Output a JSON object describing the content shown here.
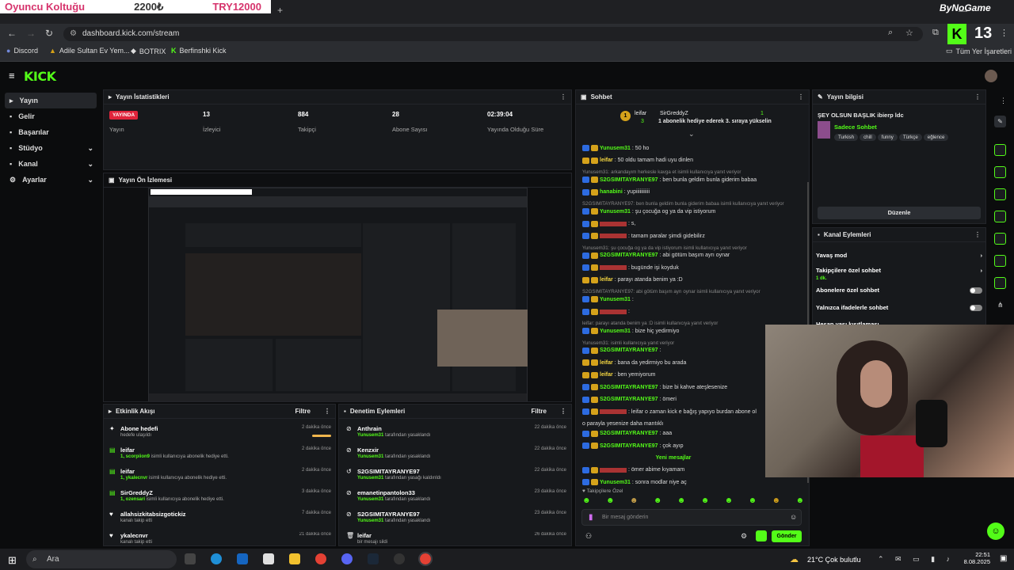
{
  "overlay": {
    "left": "Oyuncu Koltuğu",
    "mid": "2200₺",
    "right": "TRY12000",
    "right_top": "ByNoGame"
  },
  "browser": {
    "url": "dashboard.kick.com/stream",
    "channel_number": "13"
  },
  "bookmarks": [
    "Discord",
    "Adile Sultan Ev Yem...",
    "BOTRIX",
    "Berfinshki Kick"
  ],
  "bookmarks_all": "Tüm Yer İşaretleri",
  "app": {
    "logo": "KICK"
  },
  "sidebar": {
    "items": [
      {
        "label": "Yayın"
      },
      {
        "label": "Gelir"
      },
      {
        "label": "Başarılar"
      },
      {
        "label": "Stüdyo"
      },
      {
        "label": "Kanal"
      },
      {
        "label": "Ayarlar"
      }
    ]
  },
  "stats": {
    "title": "Yayın İstatistikleri",
    "live": "YAYINDA",
    "live_label": "Yayın",
    "viewers": "13",
    "viewers_label": "İzleyici",
    "followers": "884",
    "followers_label": "Takipçi",
    "subs": "28",
    "subs_label": "Abone Sayısı",
    "uptime": "02:39:04",
    "uptime_label": "Yayında Olduğu Süre"
  },
  "preview": {
    "title": "Yayın Ön İzlemesi"
  },
  "activity": {
    "title": "Etkinlik Akışı",
    "filter": "Filtre",
    "rows": [
      {
        "title": "Abone hedefi",
        "sub": "hedefe ulaşıldı",
        "time": "2 dakika önce"
      },
      {
        "title": "leifar",
        "user": "1, scorpiion9",
        "sub": " isimli kullanıcıya abonelik hediye etti.",
        "time": "2 dakika önce"
      },
      {
        "title": "leifar",
        "user": "1, ykalecnvr",
        "sub": " isimli kullanıcıya abonelik hediye etti.",
        "time": "2 dakika önce"
      },
      {
        "title": "SirGreddyZ",
        "user": "1, ozensari",
        "sub": " isimli kullanıcıya abonelik hediye etti.",
        "time": "3 dakika önce"
      },
      {
        "title": "allahsizkitabsizgotickiz",
        "sub": "kanalı takip etti",
        "time": "7 dakika önce"
      },
      {
        "title": "ykalecnvr",
        "sub": "kanalı takip etti",
        "time": "21 dakika önce"
      }
    ]
  },
  "moderation": {
    "title": "Denetim Eylemleri",
    "filter": "Filtre",
    "rows": [
      {
        "title": "Anthrain",
        "user": "Yunusem31",
        "sub": " tarafından yasaklandı",
        "time": "22 dakika önce"
      },
      {
        "title": "Kenzxir",
        "user": "Yunusem31",
        "sub": " tarafından yasaklandı",
        "time": "22 dakika önce"
      },
      {
        "title": "S2GSIMITAYRANYE97",
        "user": "Yunusem31",
        "sub": " tarafından yasağı kaldırıldı",
        "time": "22 dakika önce"
      },
      {
        "title": "emanetinpantolon33",
        "user": "Yunusem31",
        "sub": " tarafından yasaklandı",
        "time": "23 dakika önce"
      },
      {
        "title": "S2GSIMITAYRANYE97",
        "user": "Yunusem31",
        "sub": " tarafından yasaklandı",
        "time": "23 dakika önce"
      },
      {
        "title": "leifar",
        "sub": "bir mesajı sildi",
        "time": "26 dakika önce"
      }
    ]
  },
  "chat": {
    "title": "Sohbet",
    "pinned": {
      "user1": "leifar",
      "count1": "3",
      "user2": "SirGreddyZ",
      "count2": "1",
      "text": "1 abonelik hediye ederek 3. sıraya yükselin"
    },
    "messages": [
      {
        "type": "msg",
        "user": "Yunusem31",
        "color": "u-green",
        "text": ": 50 ho"
      },
      {
        "type": "msg",
        "user": "leifar",
        "color": "u-yellow",
        "text": ": 50 oldu tamam hadi uyu dinlen"
      },
      {
        "type": "reply",
        "text": "Yunusem31: arkandayım herkesle kavga et isimli kullanıcıya yanıt veriyor"
      },
      {
        "type": "msg",
        "user": "S2GSIMITAYRANYE97",
        "color": "u-green",
        "text": ": ben bunla geldim bunla giderim babaa"
      },
      {
        "type": "msg",
        "user": "hanabini",
        "color": "u-green",
        "text": ": yupiiiiiiiiiii"
      },
      {
        "type": "reply",
        "text": "S2GSIMITAYRANYE97: ben bunla geldim bunla giderim babaa isimli kullanıcıya yanıt veriyor"
      },
      {
        "type": "msg",
        "user": "Yunusem31",
        "color": "u-green",
        "text": ": şu çocuğa og ya da vip istiyorum"
      },
      {
        "type": "msg",
        "user": "",
        "color": "u-pink",
        "text": ": s,"
      },
      {
        "type": "msg",
        "user": "",
        "color": "u-purple",
        "text": ": tamam paralar şimdi gidebilirz"
      },
      {
        "type": "reply",
        "text": "Yunusem31: şu çocuğa og ya da vip istiyorum isimli kullanıcıya yanıt veriyor"
      },
      {
        "type": "msg",
        "user": "S2GSIMITAYRANYE97",
        "color": "u-green",
        "text": ": abi götüm başım ayrı oynar"
      },
      {
        "type": "msg",
        "user": "",
        "color": "u-purple",
        "text": ": bugünde işi koyduk"
      },
      {
        "type": "msg",
        "user": "leifar",
        "color": "u-yellow",
        "text": ": parayı atanda benim ya :D"
      },
      {
        "type": "reply",
        "text": "S2GSIMITAYRANYE97: abi götüm başım ayrı oynar isimli kullanıcıya yanıt veriyor"
      },
      {
        "type": "msg",
        "user": "Yunusem31",
        "color": "u-green",
        "text": ":"
      },
      {
        "type": "msg",
        "user": "",
        "color": "u-pink",
        "text": ":"
      },
      {
        "type": "reply",
        "text": "leifar: parayı atanda benim ya :D isimli kullanıcıya yanıt veriyor"
      },
      {
        "type": "msg",
        "user": "Yunusem31",
        "color": "u-green",
        "text": ": bize hiç yedirmiyo"
      },
      {
        "type": "reply",
        "text": "Yunusem31: isimli kullanıcıya yanıt veriyor"
      },
      {
        "type": "msg",
        "user": "S2GSIMITAYRANYE97",
        "color": "u-green",
        "text": ":"
      },
      {
        "type": "msg",
        "user": "leifar",
        "color": "u-yellow",
        "text": ": bana da yedirmiyo bu arada"
      },
      {
        "type": "msg",
        "user": "leifar",
        "color": "u-yellow",
        "text": ": ben yemiyorum"
      },
      {
        "type": "msg",
        "user": "S2GSIMITAYRANYE97",
        "color": "u-green",
        "text": ": bize bi kahve ateşlesenize"
      },
      {
        "type": "msg",
        "user": "S2GSIMITAYRANYE97",
        "color": "u-green",
        "text": ": ömeri"
      },
      {
        "type": "msg",
        "user": "",
        "color": "u-purple",
        "text": ": leifar o zaman kick e bağış yapıyo burdan abone ol"
      },
      {
        "type": "cont",
        "text": "o parayla yesenize daha mantıklı"
      },
      {
        "type": "msg",
        "user": "S2GSIMITAYRANYE97",
        "color": "u-green",
        "text": ": aaa"
      },
      {
        "type": "msg",
        "user": "S2GSIMITAYRANYE97",
        "color": "u-green",
        "text": ": çok ayıp"
      },
      {
        "type": "divider",
        "text": "Yeni mesajlar"
      },
      {
        "type": "msg",
        "user": "",
        "color": "u-pink",
        "text": ": ömer abime kıyamam"
      },
      {
        "type": "msg",
        "user": "Yunusem31",
        "color": "u-green",
        "text": ": sonra modlar niye aç"
      }
    ],
    "followers_only": "Takipçilere Özel",
    "input_placeholder": "Bir mesaj gönderin",
    "send": "Gönder"
  },
  "stream_info": {
    "title": "Yayın bilgisi",
    "stream_title": "ŞEY OLSUN BAŞLIK ibierp ldc",
    "category": "Sadece Sohbet",
    "tags": [
      "Turkish",
      "chill",
      "funny",
      "Türkçe",
      "eğlence"
    ],
    "edit": "Düzenle"
  },
  "channel_actions": {
    "title": "Kanal Eylemleri",
    "rows": [
      {
        "label": "Yavaş mod"
      },
      {
        "label": "Takipçilere özel sohbet",
        "sub": "1 dk."
      },
      {
        "label": "Abonelere özel sohbet"
      },
      {
        "label": "Yalnızca ifadelerle sohbet"
      },
      {
        "label": "Hesap yaşı kısıtlaması"
      }
    ]
  },
  "taskbar": {
    "search": "Ara",
    "weather": "21°C  Çok bulutlu",
    "time": "22:51",
    "date": "8.08.2025"
  }
}
